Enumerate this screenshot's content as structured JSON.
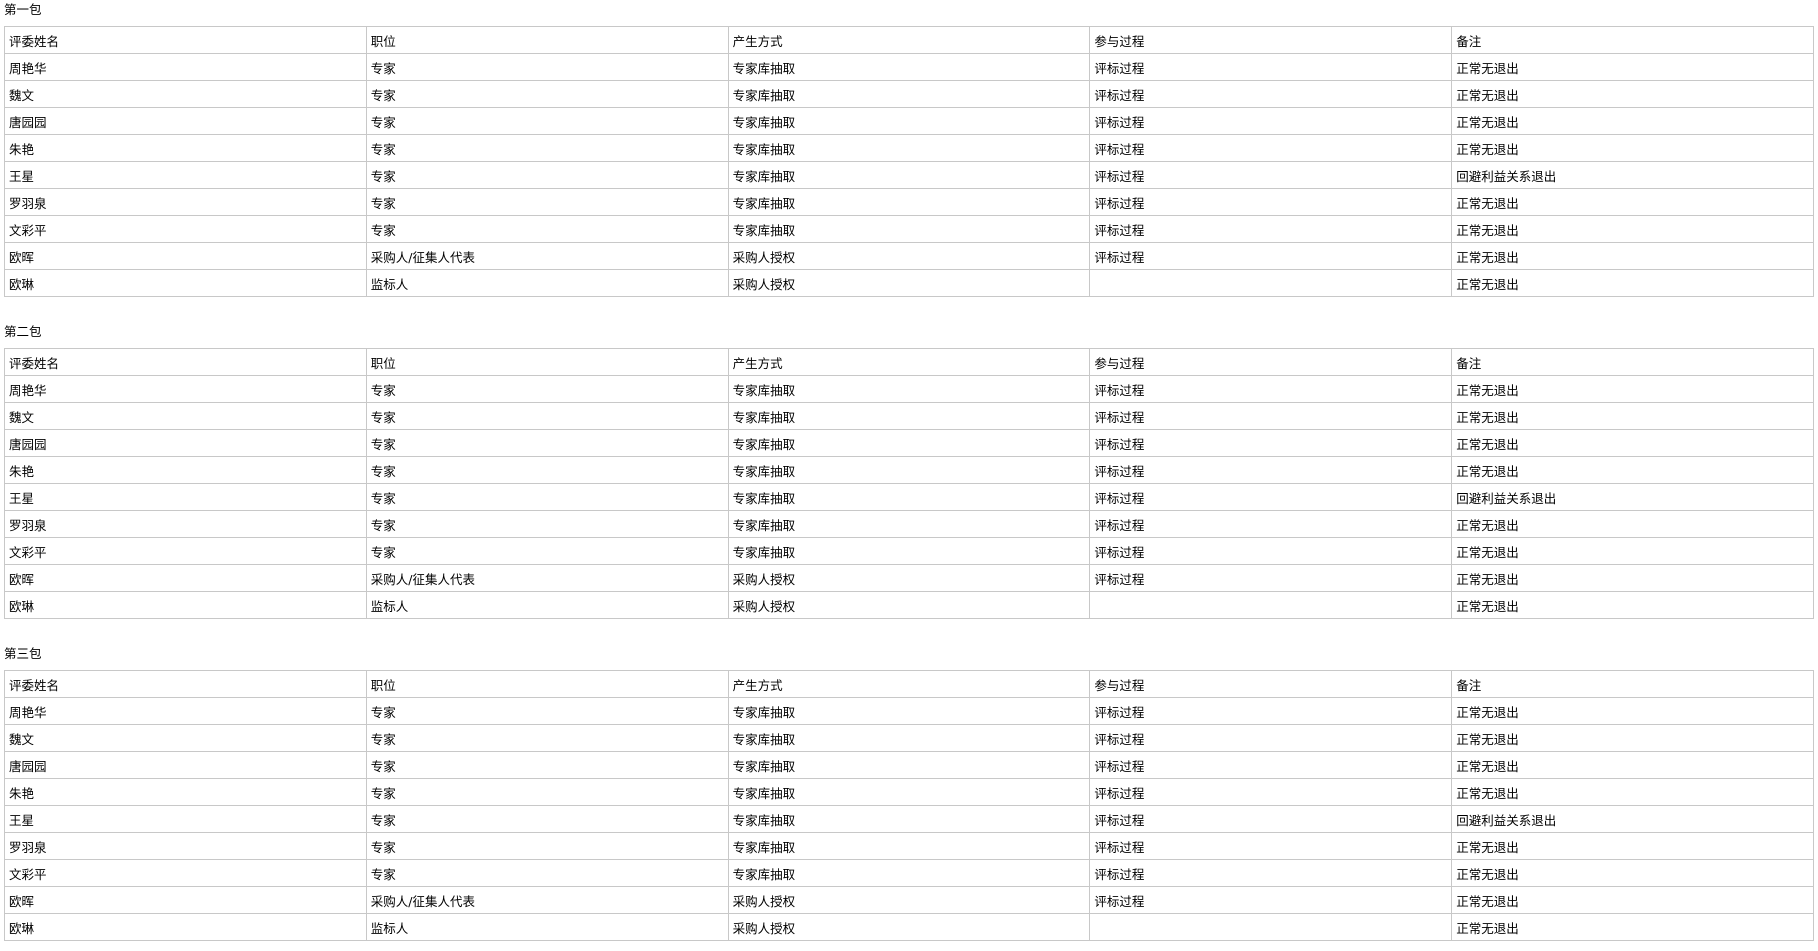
{
  "packages": [
    {
      "title": "第一包",
      "headers": [
        "评委姓名",
        "职位",
        "产生方式",
        "参与过程",
        "备注"
      ],
      "rows": [
        [
          "周艳华",
          "专家",
          "专家库抽取",
          "评标过程",
          "正常无退出"
        ],
        [
          "魏文",
          "专家",
          "专家库抽取",
          "评标过程",
          "正常无退出"
        ],
        [
          "唐园园",
          "专家",
          "专家库抽取",
          "评标过程",
          "正常无退出"
        ],
        [
          "朱艳",
          "专家",
          "专家库抽取",
          "评标过程",
          "正常无退出"
        ],
        [
          "王星",
          "专家",
          "专家库抽取",
          "评标过程",
          "回避利益关系退出"
        ],
        [
          "罗羽泉",
          "专家",
          "专家库抽取",
          "评标过程",
          "正常无退出"
        ],
        [
          "文彩平",
          "专家",
          "专家库抽取",
          "评标过程",
          "正常无退出"
        ],
        [
          "欧晖",
          "采购人/征集人代表",
          "采购人授权",
          "评标过程",
          "正常无退出"
        ],
        [
          "欧琳",
          "监标人",
          "采购人授权",
          "",
          "正常无退出"
        ]
      ]
    },
    {
      "title": "第二包",
      "headers": [
        "评委姓名",
        "职位",
        "产生方式",
        "参与过程",
        "备注"
      ],
      "rows": [
        [
          "周艳华",
          "专家",
          "专家库抽取",
          "评标过程",
          "正常无退出"
        ],
        [
          "魏文",
          "专家",
          "专家库抽取",
          "评标过程",
          "正常无退出"
        ],
        [
          "唐园园",
          "专家",
          "专家库抽取",
          "评标过程",
          "正常无退出"
        ],
        [
          "朱艳",
          "专家",
          "专家库抽取",
          "评标过程",
          "正常无退出"
        ],
        [
          "王星",
          "专家",
          "专家库抽取",
          "评标过程",
          "回避利益关系退出"
        ],
        [
          "罗羽泉",
          "专家",
          "专家库抽取",
          "评标过程",
          "正常无退出"
        ],
        [
          "文彩平",
          "专家",
          "专家库抽取",
          "评标过程",
          "正常无退出"
        ],
        [
          "欧晖",
          "采购人/征集人代表",
          "采购人授权",
          "评标过程",
          "正常无退出"
        ],
        [
          "欧琳",
          "监标人",
          "采购人授权",
          "",
          "正常无退出"
        ]
      ]
    },
    {
      "title": "第三包",
      "headers": [
        "评委姓名",
        "职位",
        "产生方式",
        "参与过程",
        "备注"
      ],
      "rows": [
        [
          "周艳华",
          "专家",
          "专家库抽取",
          "评标过程",
          "正常无退出"
        ],
        [
          "魏文",
          "专家",
          "专家库抽取",
          "评标过程",
          "正常无退出"
        ],
        [
          "唐园园",
          "专家",
          "专家库抽取",
          "评标过程",
          "正常无退出"
        ],
        [
          "朱艳",
          "专家",
          "专家库抽取",
          "评标过程",
          "正常无退出"
        ],
        [
          "王星",
          "专家",
          "专家库抽取",
          "评标过程",
          "回避利益关系退出"
        ],
        [
          "罗羽泉",
          "专家",
          "专家库抽取",
          "评标过程",
          "正常无退出"
        ],
        [
          "文彩平",
          "专家",
          "专家库抽取",
          "评标过程",
          "正常无退出"
        ],
        [
          "欧晖",
          "采购人/征集人代表",
          "采购人授权",
          "评标过程",
          "正常无退出"
        ],
        [
          "欧琳",
          "监标人",
          "采购人授权",
          "",
          "正常无退出"
        ]
      ]
    }
  ]
}
